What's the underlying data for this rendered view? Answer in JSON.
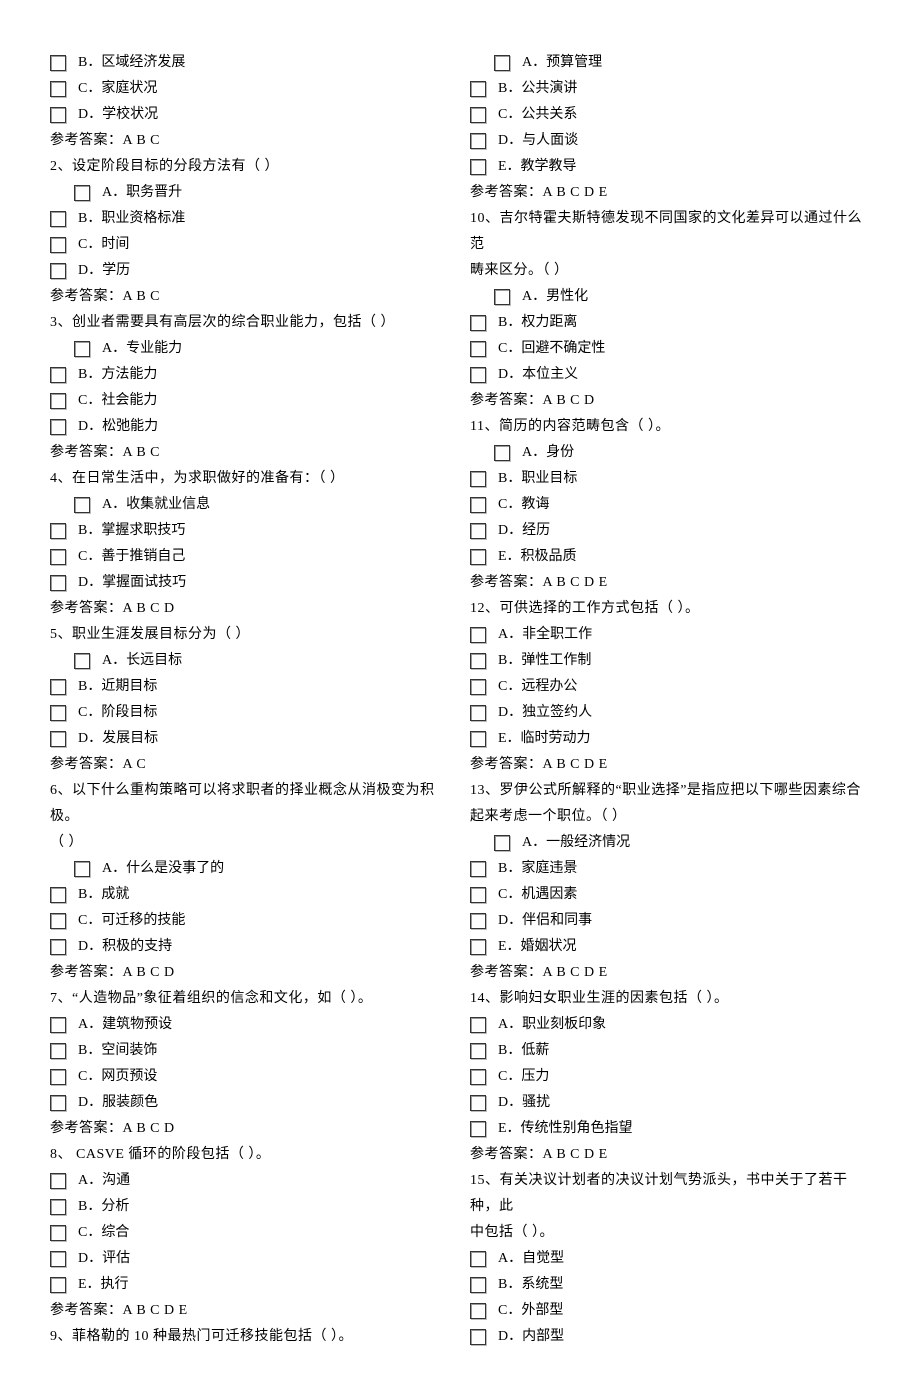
{
  "col1": {
    "q1tail_opts": [
      "B．区域经济发展",
      "C．家庭状况",
      "D．学校状况"
    ],
    "q1ans": "参考答案：A  B  C",
    "q2": "2、设定阶段目标的分段方法有（        ）",
    "q2opts": [
      "A．职务晋升",
      "B．职业资格标准",
      "C．时间",
      "D．学历"
    ],
    "q2ans": "参考答案：A  B  C",
    "q3": "3、创业者需要具有高层次的综合职业能力，包括（     ）",
    "q3opts": [
      "A．专业能力",
      "B．方法能力",
      "C．社会能力",
      "D．松弛能力"
    ],
    "q3ans": "参考答案：A  B  C",
    "q4": "4、在日常生活中，为求职做好的准备有：（          ）",
    "q4opts": [
      "A．收集就业信息",
      "B．掌握求职技巧",
      "C．善于推销自己",
      "D．掌握面试技巧"
    ],
    "q4ans": "参考答案：A  B  C  D",
    "q5": "5、职业生涯发展目标分为（     ）",
    "q5opts": [
      "A．长远目标",
      "B．近期目标",
      "C．阶段目标",
      "D．发展目标"
    ],
    "q5ans": "参考答案：A    C",
    "q6a": "6、以下什么重构策略可以将求职者的择业概念从消极变为积极。",
    "q6b": "（   ）",
    "q6opts": [
      "A．什么是没事了的",
      "B．成就",
      "C．可迁移的技能",
      "D．积极的支持"
    ],
    "q6ans": "参考答案：A  B  C  D",
    "q7": "7、“人造物品”象征着组织的信念和文化，如（       ）。",
    "q7opts": [
      "A．建筑物预设",
      "B．空间装饰",
      "C．网页预设",
      "D．服装颜色"
    ],
    "q7ans": "参考答案：A  B  C  D",
    "q8": "8、 CASVE 循环的阶段包括（       ）。",
    "q8opts": [
      "A．沟通",
      "B．分析",
      "C．综合",
      "D．评估",
      "E．执行"
    ],
    "q8ans": "参考答案：A  B  C  D  E"
  },
  "col2": {
    "q9": "9、菲格勒的 10 种最热门可迁移技能包括（            ）。",
    "q9opts": [
      "A．预算管理",
      "B．公共演讲",
      "C．公共关系",
      "D．与人面谈",
      "E．教学教导"
    ],
    "q9ans": "参考答案：A  B  C  D  E",
    "q10a": "10、吉尔特霍夫斯特德发现不同国家的文化差异可以通过什么范",
    "q10b": "畴来区分。（         ）",
    "q10opts": [
      "A．男性化",
      "B．权力距离",
      "C．回避不确定性",
      "D．本位主义"
    ],
    "q10ans": "参考答案：A  B  C  D",
    "q11": "11、简历的内容范畴包含（         ）。",
    "q11opts": [
      "A．身份",
      "B．职业目标",
      "C．教诲",
      "D．经历",
      "E．积极品质"
    ],
    "q11ans": "参考答案：A  B  C  D  E",
    "q12": "12、可供选择的工作方式包括（         ）。",
    "q12opts": [
      "A．非全职工作",
      "B．弹性工作制",
      "C．远程办公",
      "D．独立签约人",
      "E．临时劳动力"
    ],
    "q12ans": "参考答案：A  B  C  D  E",
    "q13a": "13、罗伊公式所解释的“职业选择”是指应把以下哪些因素综合",
    "q13b": "起来考虑一个职位。（   ）",
    "q13opts": [
      "A．一般经济情况",
      "B．家庭违景",
      "C．机遇因素",
      "D．伴侣和同事",
      "E．婚姻状况"
    ],
    "q13ans": "参考答案：A  B  C  D  E",
    "q14": "14、影响妇女职业生涯的因素包括（       ）。",
    "q14opts": [
      "A．职业刻板印象",
      "B．低薪",
      "C．压力",
      "D．骚扰",
      "E．传统性别角色指望"
    ],
    "q14ans": "参考答案：A  B  C  D  E",
    "q15a": "15、有关决议计划者的决议计划气势派头，书中关于了若干种，此",
    "q15b": "中包括（         ）。",
    "q15opts": [
      "A．自觉型",
      "B．系统型",
      "C．外部型",
      "D．内部型"
    ]
  }
}
